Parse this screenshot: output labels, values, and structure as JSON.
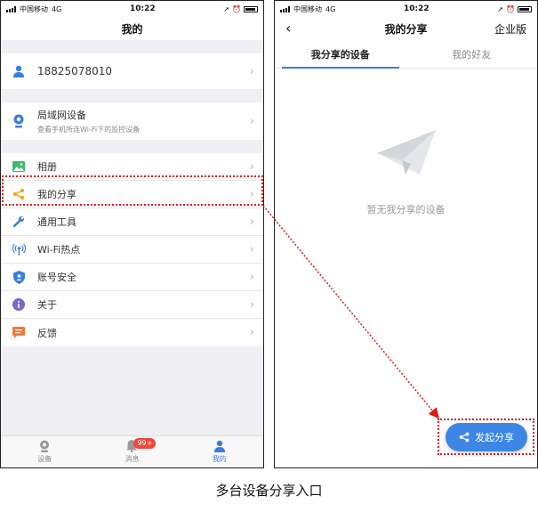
{
  "left_phone": {
    "status": {
      "carrier": "中国移动",
      "network": "4G",
      "time": "10:22"
    },
    "title": "我的",
    "account": {
      "phone": "18825078010"
    },
    "lan": {
      "title": "局域网设备",
      "subtitle": "查看手机所连Wi-Fi下的监控设备"
    },
    "menu": [
      {
        "label": "相册",
        "icon": "album-icon"
      },
      {
        "label": "我的分享",
        "icon": "share-icon"
      },
      {
        "label": "通用工具",
        "icon": "wrench-icon"
      },
      {
        "label": "Wi-Fi热点",
        "icon": "wifi-hotspot-icon"
      },
      {
        "label": "账号安全",
        "icon": "shield-icon"
      },
      {
        "label": "关于",
        "icon": "info-icon"
      },
      {
        "label": "反馈",
        "icon": "feedback-icon"
      }
    ],
    "tabs": [
      {
        "label": "设备",
        "icon": "camera-icon"
      },
      {
        "label": "消息",
        "icon": "bell-icon",
        "badge": "99+"
      },
      {
        "label": "我的",
        "icon": "person-icon"
      }
    ]
  },
  "right_phone": {
    "status": {
      "carrier": "中国移动",
      "network": "4G",
      "time": "10:22"
    },
    "title": "我的分享",
    "enterprise": "企业版",
    "segments": [
      "我分享的设备",
      "我的好友"
    ],
    "empty_text": "暂无我分享的设备",
    "fab_label": "发起分享"
  },
  "caption": "多台设备分享入口",
  "colors": {
    "accent": "#3b7de0",
    "highlight": "#e01919",
    "badge": "#f0453a",
    "share_orange": "#f5a623"
  }
}
